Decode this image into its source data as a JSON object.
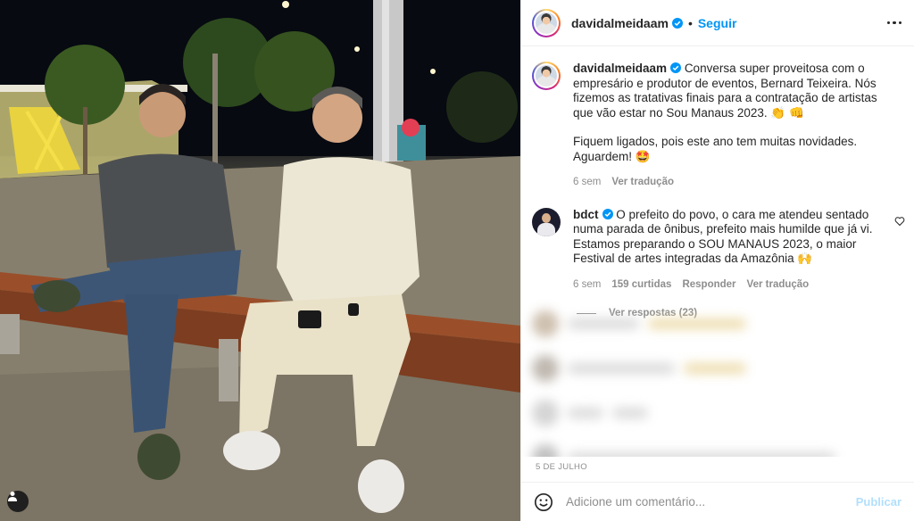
{
  "post": {
    "author": "davidalmeidaam",
    "separator": "•",
    "follow_label": "Seguir",
    "date": "5 DE JULHO"
  },
  "caption": {
    "username": "davidalmeidaam",
    "text_1": "Conversa super proveitosa com o empresário e produtor de eventos, Bernard Teixeira. Nós fizemos as tratativas finais para a contratação de artistas que vão estar no Sou Manaus 2023. 👏 👊",
    "text_2": "Fiquem ligados, pois este ano tem muitas novidades. Aguardem! 🤩",
    "time": "6 sem",
    "translate": "Ver tradução"
  },
  "comment": {
    "username": "bdct",
    "text": "O prefeito do povo, o cara me atendeu sentado numa parada de ônibus, prefeito mais humilde que já vi. Estamos preparando o SOU MANAUS 2023, o maior Festival de artes integradas da Amazônia 🙌",
    "time": "6 sem",
    "likes": "159 curtidas",
    "reply": "Responder",
    "translate": "Ver tradução",
    "view_replies": "Ver respostas (23)"
  },
  "composer": {
    "placeholder": "Adicione um comentário...",
    "publish_label": "Publicar"
  },
  "icons": {
    "verified": "verified-badge-icon",
    "more": "more-options-icon",
    "heart": "heart-icon",
    "emoji": "emoji-icon",
    "tag": "user-tag-icon"
  },
  "colors": {
    "link": "#0095f6",
    "muted": "#8e8e8e",
    "text": "#262626",
    "publish_disabled": "#b2dffc"
  }
}
